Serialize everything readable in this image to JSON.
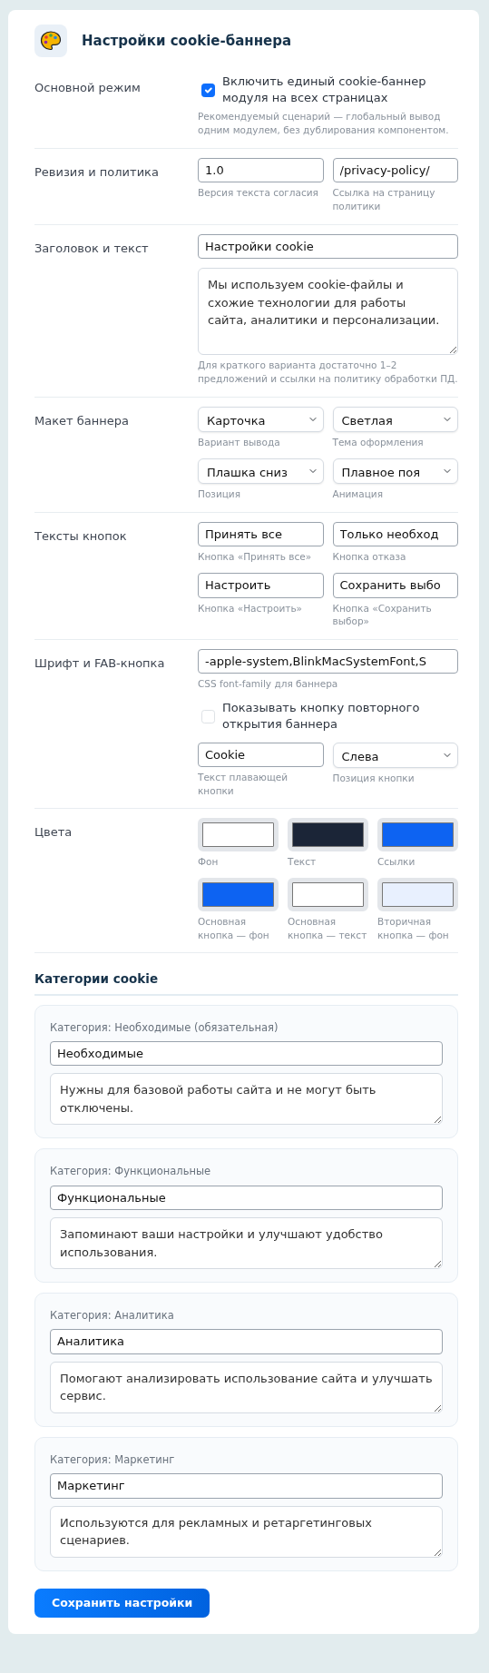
{
  "title": "Настройки cookie-баннера",
  "rows": [
    {
      "label": "Основной режим",
      "groups": [
        [
          {
            "kind": "checkbox",
            "label": "Включить единый cookie-баннер модуля на всех страницах",
            "checked": true,
            "hint": "Рекомендуемый сценарий — глобальный вывод одним модулем, без дублирования компонентом."
          }
        ]
      ]
    },
    {
      "label": "Ревизия и политика",
      "groups": [
        [
          {
            "kind": "input",
            "value": "1.0",
            "hint": "Версия текста согласия"
          },
          {
            "kind": "input",
            "value": "/privacy-policy/",
            "hint": "Ссылка на страницу политики"
          }
        ]
      ]
    },
    {
      "label": "Заголовок и текст",
      "groups": [
        [
          {
            "kind": "input",
            "value": "Настройки cookie"
          }
        ],
        [
          {
            "kind": "textarea",
            "value": "Мы используем cookie-файлы и схожие технологии для работы сайта, аналитики и персонализации.",
            "hint": "Для краткого варианта достаточно 1–2 предложений и ссылки на политику обработки ПД."
          }
        ]
      ]
    },
    {
      "label": "Макет баннера",
      "groups": [
        [
          {
            "kind": "select",
            "value": "Карточка",
            "hint": "Вариант вывода"
          },
          {
            "kind": "select",
            "value": "Светлая",
            "hint": "Тема оформления"
          }
        ],
        [
          {
            "kind": "select",
            "value": "Плашка сниз",
            "hint": "Позиция"
          },
          {
            "kind": "select",
            "value": "Плавное поя",
            "hint": "Анимация"
          }
        ]
      ]
    },
    {
      "label": "Тексты кнопок",
      "groups": [
        [
          {
            "kind": "input",
            "value": "Принять все",
            "hint": "Кнопка «Принять все»"
          },
          {
            "kind": "input",
            "value": "Только необход",
            "hint": "Кнопка отказа"
          }
        ],
        [
          {
            "kind": "input",
            "value": "Настроить",
            "hint": "Кнопка «Настроить»"
          },
          {
            "kind": "input",
            "value": "Сохранить выбо",
            "hint": "Кнопка «Сохранить выбор»"
          }
        ]
      ]
    },
    {
      "label": "Шрифт и FAB-кнопка",
      "groups": [
        [
          {
            "kind": "input",
            "value": "-apple-system,BlinkMacSystemFont,S",
            "hint": "CSS font-family для баннера"
          }
        ],
        [
          {
            "kind": "checkbox",
            "label": "Показывать кнопку повторного открытия баннера",
            "checked": false
          }
        ],
        [
          {
            "kind": "input",
            "value": "Cookie",
            "hint": "Текст плавающей кнопки"
          },
          {
            "kind": "select",
            "value": "Слева",
            "hint": "Позиция кнопки"
          }
        ]
      ]
    },
    {
      "label": "Цвета",
      "groups": [
        [
          {
            "kind": "color",
            "color": "#ffffff",
            "hint": "Фон"
          },
          {
            "kind": "color",
            "color": "#1b2537",
            "hint": "Текст"
          },
          {
            "kind": "color",
            "color": "#0d63f2",
            "hint": "Ссылки"
          }
        ],
        [
          {
            "kind": "color",
            "color": "#0d63f2",
            "hint": "Основная кнопка — фон"
          },
          {
            "kind": "color",
            "color": "#ffffff",
            "hint": "Основная кнопка — текст"
          },
          {
            "kind": "color",
            "color": "#e8f0fe",
            "hint": "Вторичная кнопка — фон"
          }
        ]
      ]
    }
  ],
  "categories_heading": "Категории cookie",
  "categories": [
    {
      "title": "Категория: Необходимые (обязательная)",
      "name": "Необходимые",
      "description": "Нужны для базовой работы сайта и не могут быть отключены."
    },
    {
      "title": "Категория: Функциональные",
      "name": "Функциональные",
      "description": "Запоминают ваши настройки и улучшают удобство использования."
    },
    {
      "title": "Категория: Аналитика",
      "name": "Аналитика",
      "description": "Помогают анализировать использование сайта и улучшать сервис."
    },
    {
      "title": "Категория: Маркетинг",
      "name": "Маркетинг",
      "description": "Используются для рекламных и ретаргетинговых сценариев."
    }
  ],
  "save_button": "Сохранить настройки"
}
